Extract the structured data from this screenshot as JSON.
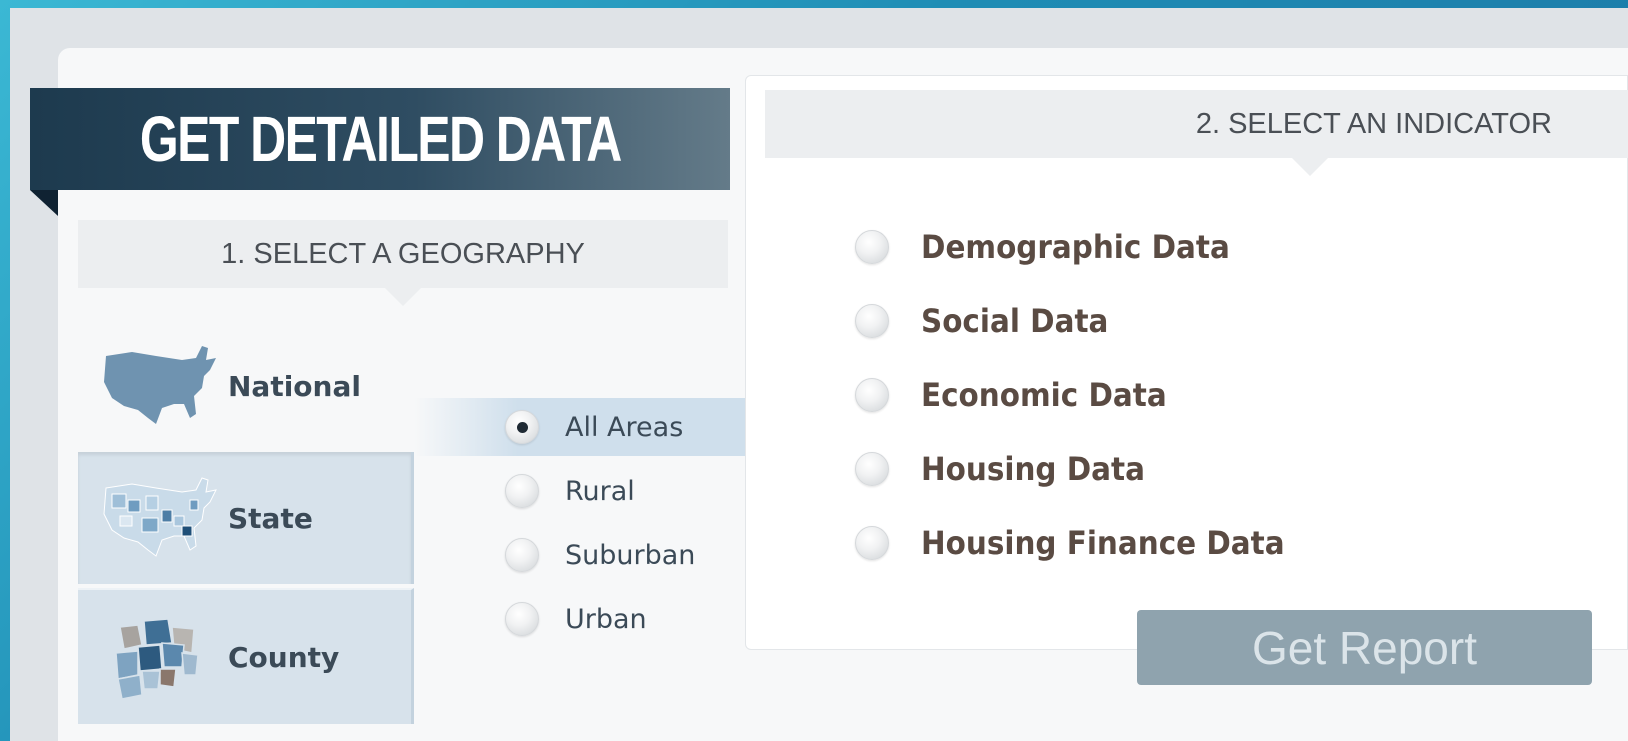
{
  "banner": {
    "title": "GET DETAILED DATA"
  },
  "steps": {
    "geography": "1. SELECT A GEOGRAPHY",
    "indicator": "2. SELECT AN INDICATOR"
  },
  "geography": {
    "items": [
      {
        "label": "National",
        "icon": "us-map-icon",
        "selected": true
      },
      {
        "label": "State",
        "icon": "state-map-icon",
        "selected": false
      },
      {
        "label": "County",
        "icon": "county-map-icon",
        "selected": false
      }
    ]
  },
  "areas": {
    "options": [
      {
        "label": "All Areas",
        "checked": true
      },
      {
        "label": "Rural",
        "checked": false
      },
      {
        "label": "Suburban",
        "checked": false
      },
      {
        "label": "Urban",
        "checked": false
      }
    ]
  },
  "indicators": {
    "options": [
      {
        "label": "Demographic Data",
        "checked": false
      },
      {
        "label": "Social Data",
        "checked": false
      },
      {
        "label": "Economic Data",
        "checked": false
      },
      {
        "label": "Housing Data",
        "checked": false
      },
      {
        "label": "Housing Finance Data",
        "checked": false
      }
    ]
  },
  "actions": {
    "get_report": "Get Report"
  },
  "colors": {
    "banner_dark": "#1d3a4e",
    "highlight": "#cfdfec",
    "button": "#8fa3ae",
    "map_blue": "#6f93b0"
  }
}
